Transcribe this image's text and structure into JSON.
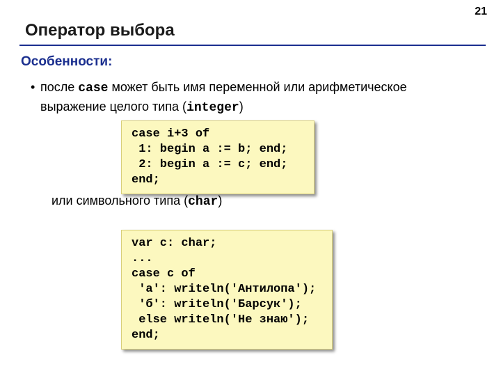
{
  "page_number": "21",
  "title": "Оператор выбора",
  "subtitle": "Особенности:",
  "bullet_text_before": "после ",
  "bullet_code1": "case",
  "bullet_text_mid": " может быть имя переменной или арифметическое выражение целого типа (",
  "bullet_code2": "integer",
  "bullet_text_after": ")",
  "code1": "case i+3 of\n 1: begin a := b; end;\n 2: begin a := c; end;\nend;",
  "text2_before": "или символьного типа (",
  "text2_code": "char",
  "text2_after": ")",
  "code2": "var c: char;\n...\ncase c of\n 'а': writeln('Антилопа');\n 'б': writeln('Барсук');\n else writeln('Не знаю');\nend;"
}
